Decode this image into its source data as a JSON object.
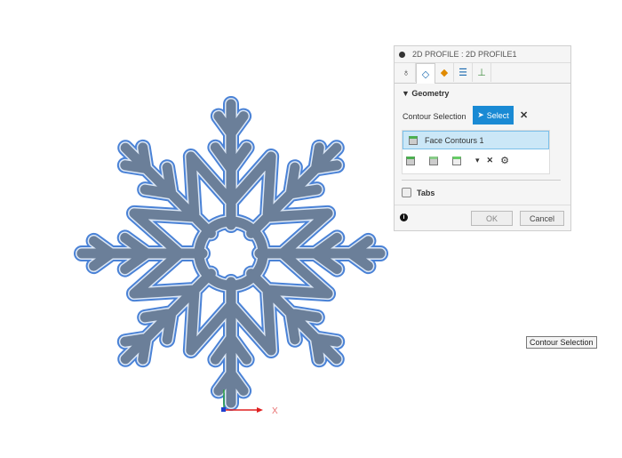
{
  "viewport": {
    "axis_label": "X",
    "colors": {
      "profile_fill": "#6b7f99",
      "profile_edge": "#4a82d6",
      "x_axis": "#e02020",
      "y_axis": "#2aa040"
    }
  },
  "dialog": {
    "title": "2D PROFILE : 2D PROFILE1",
    "tabs": [
      "tool-icon",
      "geometry-icon",
      "heights-icon",
      "passes-icon",
      "linking-icon"
    ],
    "section": "Geometry",
    "contour_label": "Contour Selection",
    "select_label": "Select",
    "selection_item": "Face Contours 1",
    "tabs_label": "Tabs",
    "tabs_checked": false,
    "ok": "OK",
    "cancel": "Cancel",
    "accent": "#1a8ad4"
  },
  "tooltip": "Contour Selection"
}
